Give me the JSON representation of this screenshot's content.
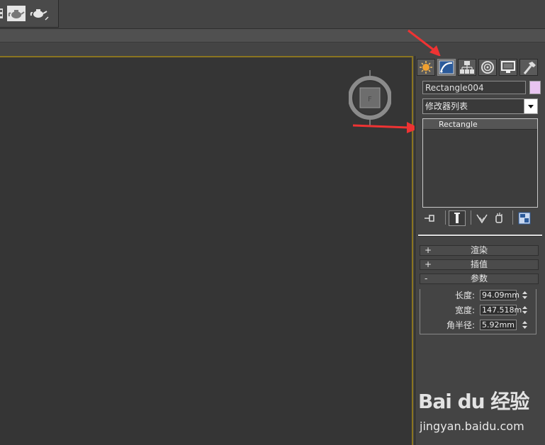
{
  "object_name": "Rectangle004",
  "object_color": "#e8c4f0",
  "modifier_list": {
    "selected": "修改器列表"
  },
  "stack": {
    "items": [
      "Rectangle"
    ]
  },
  "rollouts": [
    {
      "sign": "+",
      "title": "渲染"
    },
    {
      "sign": "+",
      "title": "插值"
    },
    {
      "sign": "-",
      "title": "参数"
    }
  ],
  "parameters": {
    "length": {
      "label": "长度:",
      "value": "94.09mm"
    },
    "width": {
      "label": "宽度:",
      "value": "147.518m"
    },
    "corner_radius": {
      "label": "角半径:",
      "value": "5.92mm"
    }
  },
  "command_tabs": [
    "create",
    "modify",
    "hierarchy",
    "motion",
    "display",
    "utilities"
  ],
  "active_tab": "modify",
  "colors": {
    "viewport_border": "#8a7420",
    "arrow": "#ee3333"
  },
  "watermark": {
    "logo": "Bai du 经验",
    "url": "jingyan.baidu.com"
  }
}
